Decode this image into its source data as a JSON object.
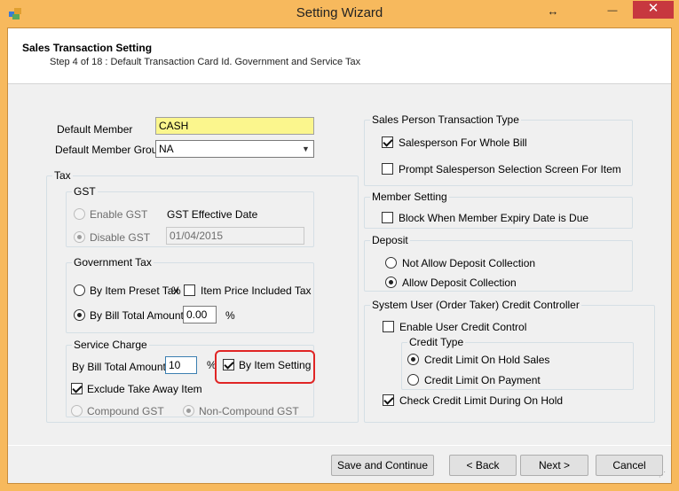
{
  "window": {
    "title": "Setting Wizard",
    "maximize_label": "↔",
    "minimize_label": "—",
    "close_label": "✕"
  },
  "header": {
    "title": "Sales Transaction Setting",
    "subtitle": "Step 4 of 18 : Default Transaction Card Id. Government and Service Tax"
  },
  "member": {
    "default_member_label": "Default Member",
    "default_member_value": "CASH",
    "group_label": "Default Member Group",
    "group_value": "NA"
  },
  "tax": {
    "legend": "Tax",
    "gst": {
      "legend": "GST",
      "enable_label": "Enable GST",
      "disable_label": "Disable GST",
      "effective_date_label": "GST Effective Date",
      "effective_date_value": "01/04/2015"
    },
    "gov": {
      "legend": "Government Tax",
      "by_item_label": "By Item Preset Tax",
      "percent1": "%",
      "item_included_label": "Item Price Included Tax",
      "by_bill_label": "By Bill Total Amount",
      "by_bill_value": "0.00",
      "percent2": "%"
    },
    "service": {
      "legend": "Service Charge",
      "by_bill_label": "By Bill Total Amount",
      "by_bill_value": "10",
      "percent": "%",
      "by_item_setting_label": "By Item Setting",
      "exclude_label": "Exclude Take Away Item",
      "compound_label": "Compound GST",
      "non_compound_label": "Non-Compound GST"
    }
  },
  "salesperson": {
    "legend": "Sales Person Transaction Type",
    "whole_bill_label": "Salesperson For Whole Bill",
    "prompt_label": "Prompt Salesperson Selection Screen For Item"
  },
  "member_setting": {
    "legend": "Member Setting",
    "block_label": "Block When Member Expiry Date is Due"
  },
  "deposit": {
    "legend": "Deposit",
    "not_allow_label": "Not Allow Deposit Collection",
    "allow_label": "Allow Deposit Collection"
  },
  "credit": {
    "legend": "System User (Order Taker) Credit Controller",
    "enable_label": "Enable User Credit Control",
    "type_legend": "Credit Type",
    "on_hold_label": "Credit Limit On Hold Sales",
    "on_payment_label": "Credit Limit On Payment",
    "check_label": "Check Credit Limit During On Hold"
  },
  "buttons": {
    "save": "Save and Continue",
    "back": "< Back",
    "next": "Next >",
    "cancel": "Cancel"
  },
  "colors": {
    "title_bar": "#f7b95d",
    "close": "#c7383f",
    "highlight": "#e02525",
    "member_field": "#fbf68d"
  }
}
